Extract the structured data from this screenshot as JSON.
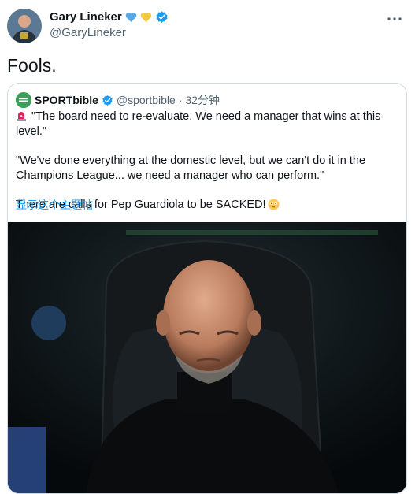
{
  "author": {
    "display_name": "Gary Lineker",
    "handle": "@GaryLineker",
    "badges": [
      "blue-heart-icon",
      "yellow-heart-icon",
      "verified-icon"
    ]
  },
  "tweet": {
    "text": "Fools."
  },
  "quote": {
    "display_name": "SPORTbible",
    "handle": "@sportbible",
    "time": "· 32分钟",
    "line1": "\"The board need to re-evaluate. We need a manager that wins at this level.\"",
    "line2": "\"We've done everything at the domestic level, but we can't do it in the Champions League... we need a manager who can perform.\"",
    "line3": "There are calls for Pep Guardiola to be SACKED!",
    "show_thread": "显示这个主题帖"
  },
  "colors": {
    "link": "#1d9bf0",
    "verified": "#1d9bf0",
    "secondary_text": "#536471",
    "border": "#cfd9de"
  }
}
